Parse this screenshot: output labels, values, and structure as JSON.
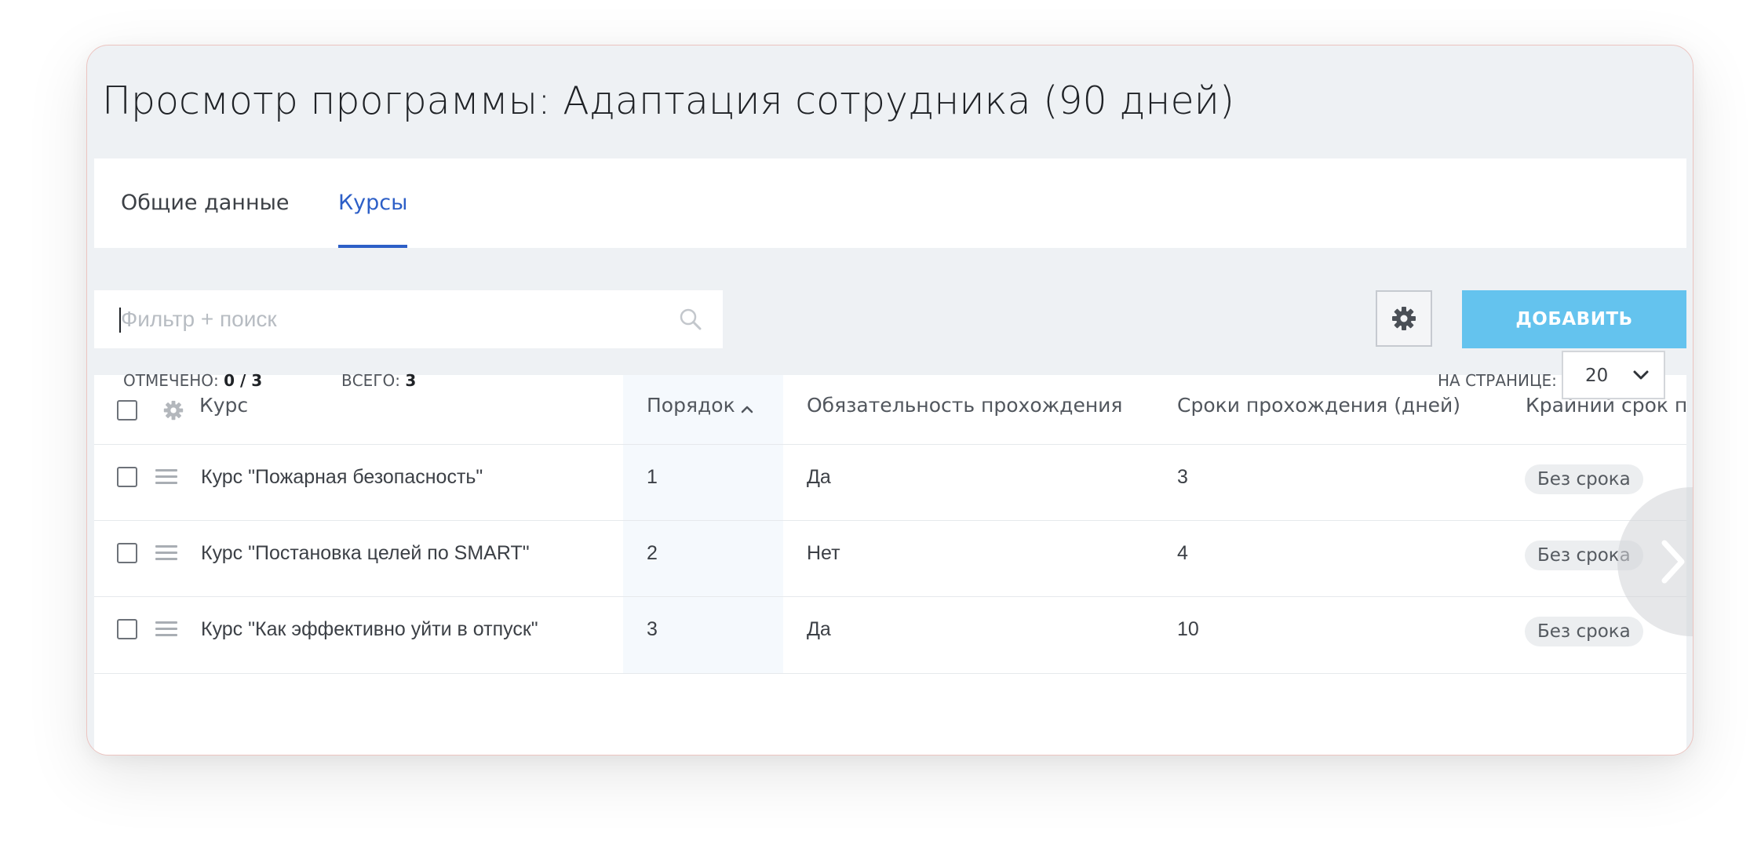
{
  "page": {
    "title": "Просмотр программы: Адаптация сотрудника (90 дней)"
  },
  "tabs": [
    {
      "label": "Общие данные",
      "active": false
    },
    {
      "label": "Курсы",
      "active": true
    }
  ],
  "toolbar": {
    "search_placeholder": "Фильтр + поиск",
    "search_value": "",
    "settings_icon": "gear-icon",
    "add_label": "ДОБАВИТЬ"
  },
  "table": {
    "columns": [
      {
        "label": "Курс"
      },
      {
        "label": "Порядок",
        "sorted": "asc"
      },
      {
        "label": "Обязательность прохождения"
      },
      {
        "label": "Сроки прохождения (дней)"
      },
      {
        "label": "Крайний срок пр"
      }
    ],
    "rows": [
      {
        "course": "Курс \"Пожарная безопасность\"",
        "order": "1",
        "required": "Да",
        "days": "3",
        "deadline": "Без срока"
      },
      {
        "course": "Курс \"Постановка целей по SMART\"",
        "order": "2",
        "required": "Нет",
        "days": "4",
        "deadline": "Без срока"
      },
      {
        "course": "Курс \"Как эффективно уйти в отпуск\"",
        "order": "3",
        "required": "Да",
        "days": "10",
        "deadline": "Без срока"
      }
    ]
  },
  "footer": {
    "selected_label": "ОТМЕЧЕНО:",
    "selected_value": "0 / 3",
    "total_label": "ВСЕГО:",
    "total_value": "3",
    "per_page_label": "НА СТРАНИЦЕ:",
    "per_page_value": "20"
  },
  "colors": {
    "accent": "#2d5fc7",
    "add_button": "#64c3ee",
    "background": "#eef1f4"
  }
}
